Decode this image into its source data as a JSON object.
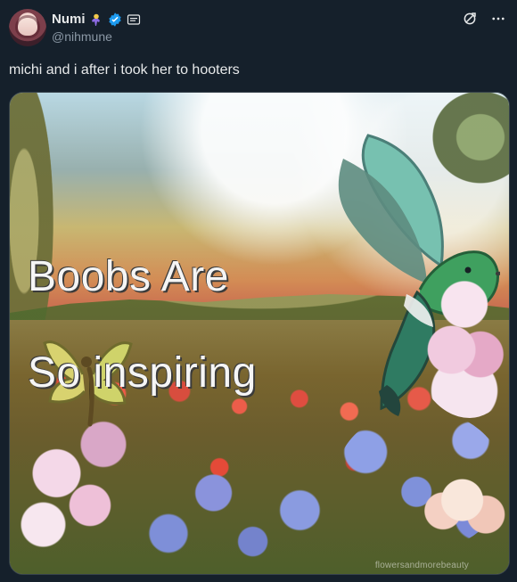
{
  "post": {
    "display_name": "Numi",
    "handle": "@nihmune",
    "text": "michi and i after i took her to hooters"
  },
  "media": {
    "caption_line_1": "Boobs Are",
    "caption_line_2": "So inspiring",
    "watermark": "flowersandmorebeauty"
  },
  "icons": {
    "badge": "trophy-badge-icon",
    "verified": "verified-badge-icon",
    "card": "identity-card-icon",
    "translate": "translate-icon",
    "more": "more-icon"
  },
  "colors": {
    "background": "#15202b",
    "text_primary": "#e7e9ea",
    "text_secondary": "#8b98a5",
    "verified": "#1d9bf0"
  }
}
